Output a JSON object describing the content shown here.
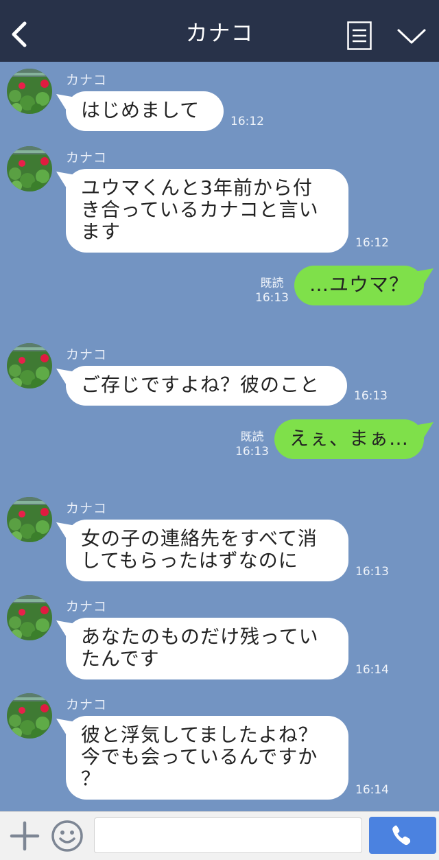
{
  "header": {
    "title": "カナコ"
  },
  "chat": {
    "partner_name": "カナコ",
    "read_label": "既読",
    "messages": [
      {
        "from": "partner",
        "lines": [
          "はじめまして"
        ],
        "time": "16:12"
      },
      {
        "from": "partner",
        "lines": [
          "ユウマくんと3年前から付",
          "き合っているカナコと言い",
          "ます"
        ],
        "time": "16:12"
      },
      {
        "from": "me",
        "lines": [
          "…ユウマ？"
        ],
        "time": "16:13",
        "read": "既読"
      },
      {
        "from": "partner",
        "lines": [
          "ご存じですよね？彼のこと"
        ],
        "time": "16:13"
      },
      {
        "from": "me",
        "lines": [
          "えぇ、まぁ…"
        ],
        "time": "16:13",
        "read": "既読"
      },
      {
        "from": "partner",
        "lines": [
          "女の子の連絡先をすべて消",
          "してもらったはずなのに"
        ],
        "time": "16:13"
      },
      {
        "from": "partner",
        "lines": [
          "あなたのものだけ残ってい",
          "たんです"
        ],
        "time": "16:14"
      },
      {
        "from": "partner",
        "lines": [
          "彼と浮気してましたよね？",
          "今でも会っているんですか",
          "？"
        ],
        "time": "16:14"
      }
    ]
  },
  "footer": {
    "input_value": ""
  },
  "colors": {
    "header_bg": "#283249",
    "chat_bg": "#7394c2",
    "incoming_bubble": "#ffffff",
    "outgoing_bubble": "#7fe04a",
    "call_button": "#4b82e0"
  },
  "icons": [
    "back-icon",
    "menu-icon",
    "chevron-down-icon",
    "plus-icon",
    "smile-icon",
    "phone-icon"
  ]
}
